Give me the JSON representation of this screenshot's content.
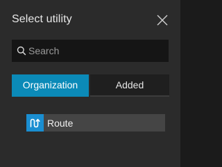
{
  "panel": {
    "title": "Select utility"
  },
  "search": {
    "placeholder": "Search",
    "value": ""
  },
  "tabs": [
    {
      "label": "Organization",
      "active": true
    },
    {
      "label": "Added",
      "active": false
    }
  ],
  "utilities": [
    {
      "label": "Route",
      "icon": "route-icon"
    }
  ],
  "colors": {
    "accent": "#0b8ab8",
    "icon_bg": "#1a8ed1",
    "panel_bg": "#2b2b2b"
  }
}
